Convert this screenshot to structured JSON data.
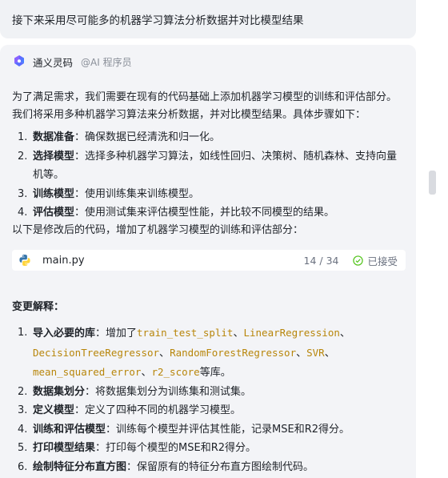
{
  "user_message": "接下来采用尽可能多的机器学习算法分析数据并对比模型结果",
  "assistant": {
    "name": "通义灵码",
    "role_tag": "@AI 程序员"
  },
  "intro": {
    "line1": "为了满足需求，我们需要在现有的代码基础上添加机器学习模型的训练和评估部分。",
    "line2": "我们将采用多种机器学习算法来分析数据，并对比模型结果。具体步骤如下："
  },
  "steps": [
    {
      "num": "1.",
      "title": "数据准备",
      "text": "：确保数据已经清洗和归一化。"
    },
    {
      "num": "2.",
      "title": "选择模型",
      "text": "：选择多种机器学习算法，如线性回归、决策树、随机森林、支持向量",
      "text_cont": "机等。"
    },
    {
      "num": "3.",
      "title": "训练模型",
      "text": "：使用训练集来训练模型。"
    },
    {
      "num": "4.",
      "title": "评估模型",
      "text": "：使用测试集来评估模型性能，并比较不同模型的结果。"
    }
  ],
  "code_intro": "以下是修改后的代码，增加了机器学习模型的训练和评估部分：",
  "code_file": {
    "name": "main.py",
    "lines": "14 / 34",
    "status": "已接受"
  },
  "changes_title": "变更解释：",
  "changes": {
    "c1": {
      "num": "1.",
      "title": "导入必要的库",
      "prefix": "：增加了",
      "ident1": "train_test_split",
      "sep1": "、",
      "ident2": "LinearRegression",
      "sep2": "、",
      "ident3": "DecisionTreeRegressor",
      "sep3": "、",
      "ident4": "RandomForestRegressor",
      "sep4": "、",
      "ident5": "SVR",
      "sep5": "、",
      "ident6": "mean_squared_error",
      "sep6": "、",
      "ident7": "r2_score",
      "suffix": "等库。"
    },
    "c2": {
      "num": "2.",
      "title": "数据集划分",
      "text": "：将数据集划分为训练集和测试集。"
    },
    "c3": {
      "num": "3.",
      "title": "定义模型",
      "text": "：定义了四种不同的机器学习模型。"
    },
    "c4": {
      "num": "4.",
      "title": "训练和评估模型",
      "text": "：训练每个模型并评估其性能，记录MSE和R2得分。"
    },
    "c5": {
      "num": "5.",
      "title": "打印模型结果",
      "text": "：打印每个模型的MSE和R2得分。"
    },
    "c6": {
      "num": "6.",
      "title": "绘制特征分布直方图",
      "text": "：保留原有的特征分布直方图绘制代码。"
    }
  },
  "colors": {
    "identifier": "#b8860b",
    "card_bg": "#f3f4f7",
    "accept_green": "#52c41a"
  }
}
